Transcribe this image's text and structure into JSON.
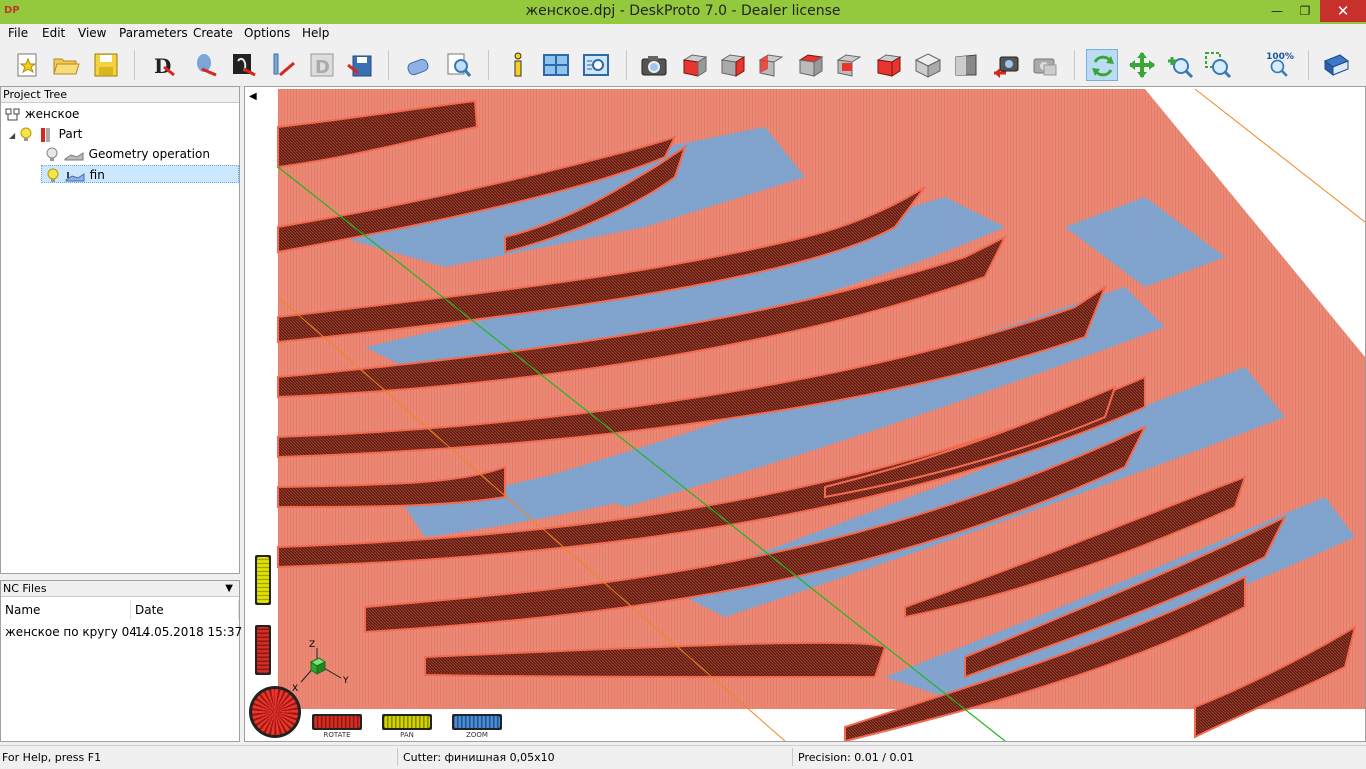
{
  "window": {
    "app_icon": "DP",
    "title": "женское.dpj - DeskProto 7.0 - Dealer license",
    "controls": {
      "minimize": "—",
      "maximize": "❐",
      "close": "✕"
    }
  },
  "menu": [
    "File",
    "Edit",
    "View",
    "Parameters",
    "Create",
    "Options",
    "Help"
  ],
  "toolbar": {
    "zoom_100_label": "100%",
    "groups": [
      [
        "new-star-icon",
        "open-folder-icon",
        "save-disk-icon"
      ],
      [
        "drawing-d-icon",
        "wizard-arrow-icon",
        "sketch-arrow-icon",
        "vector-line-icon",
        "d-grey-icon",
        "save-red-icon"
      ],
      [
        "eraser-icon",
        "magnifier-preview-icon"
      ],
      [
        "info-icon",
        "split-view-icon",
        "list-zoom-icon"
      ],
      [
        "camera-icon",
        "cube-front-icon",
        "cube-red-icon",
        "cube-side-icon",
        "cube-top-icon",
        "cube-iso-icon",
        "cube-bottom-icon",
        "cube-grey-icon",
        "cube-half-icon",
        "camera-back-icon",
        "camera-grey-icon"
      ],
      [
        "rotate-mode-icon",
        "pan-mode-icon",
        "zoom-mode-icon",
        "zoom-window-icon",
        "zoom-100-icon"
      ],
      [
        "help-book-icon"
      ]
    ]
  },
  "project_tree": {
    "header": "Project Tree",
    "items": [
      {
        "label": "женское",
        "level": 0,
        "icon": "project-icon"
      },
      {
        "label": "Part",
        "level": 1,
        "icon": "part-icon"
      },
      {
        "label": "Geometry operation",
        "level": 2,
        "icon": "geometry-icon"
      },
      {
        "label": "fin",
        "level": 2,
        "icon": "operation-icon",
        "selected": true
      }
    ]
  },
  "nc_files": {
    "header": "NC Files",
    "columns": [
      "Name",
      "Date"
    ],
    "rows": [
      {
        "name": "женское по кругу 04...",
        "date": "14.05.2018 15:37"
      }
    ]
  },
  "view_controls": {
    "rotate_label": "ROTATE",
    "pan_label": "PAN",
    "zoom_label": "ZOOM",
    "axes": {
      "x": "X",
      "y": "Y",
      "z": "Z"
    }
  },
  "statusbar": {
    "help": "For Help, press F1",
    "cutter": "Cutter: финишная 0,05x10",
    "precision": "Precision: 0.01 / 0.01"
  },
  "colors": {
    "titlebar": "#95c93d",
    "toolpath": "#f26a4f",
    "model": "#6ea9de",
    "accent": "#1a56a0"
  }
}
